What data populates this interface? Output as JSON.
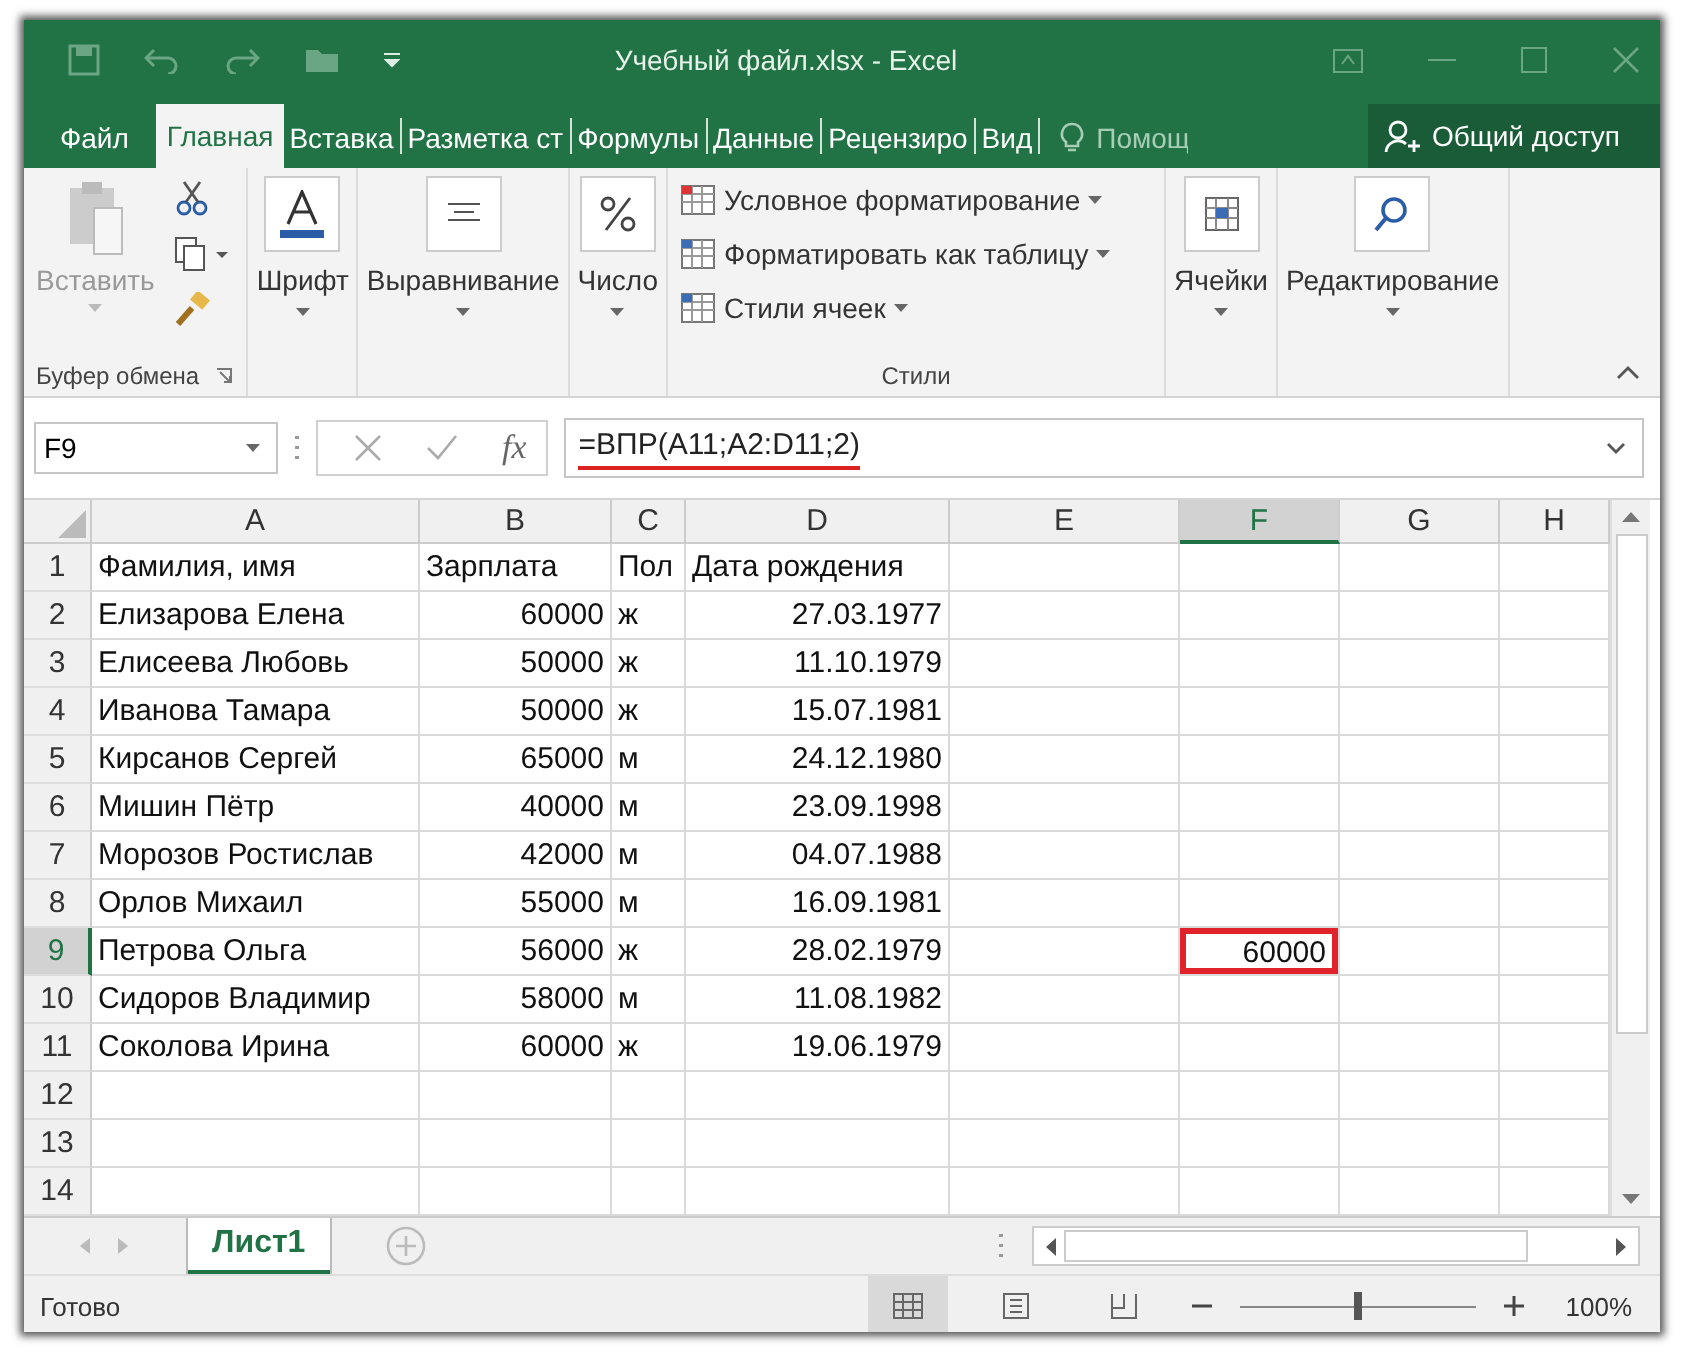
{
  "window": {
    "title": "Учебный файл.xlsx - Excel"
  },
  "ribbon_tabs": [
    {
      "label": "Файл",
      "selected": false
    },
    {
      "label": "Главная",
      "selected": true
    },
    {
      "label": "Вставка",
      "selected": false
    },
    {
      "label": "Разметка ст",
      "selected": false
    },
    {
      "label": "Формулы",
      "selected": false
    },
    {
      "label": "Данные",
      "selected": false
    },
    {
      "label": "Рецензиро",
      "selected": false
    },
    {
      "label": "Вид",
      "selected": false
    }
  ],
  "tell_me": {
    "placeholder": "Помощ"
  },
  "share_button": {
    "label": "Общий доступ"
  },
  "ribbon": {
    "paste": {
      "label": "Вставить",
      "disabled": true
    },
    "clipboard_label": "Буфер обмена",
    "big_buttons": [
      {
        "label": "Шрифт",
        "kind": "font"
      },
      {
        "label": "Выравнивание",
        "kind": "align"
      },
      {
        "label": "Число",
        "kind": "number"
      }
    ],
    "styles": [
      "Условное форматирование",
      "Форматировать как таблицу",
      "Стили ячеек"
    ],
    "styles_label": "Стили",
    "right_buttons": [
      {
        "label": "Ячейки",
        "kind": "cells"
      },
      {
        "label": "Редактирование",
        "kind": "search"
      }
    ]
  },
  "formula_bar": {
    "name_box": "F9",
    "function_button": "fx",
    "formula": "=ВПР(A11;A2:D11;2)",
    "underlined": true
  },
  "columns": [
    "A",
    "B",
    "C",
    "D",
    "E",
    "F",
    "G",
    "H"
  ],
  "rows": [
    {
      "number": "1",
      "cells": [
        "Фамилия, имя",
        "Зарплата",
        "Пол",
        "Дата рождения"
      ]
    },
    {
      "number": "2",
      "cells": [
        "Елизарова Елена",
        "60000",
        "ж",
        "27.03.1977"
      ]
    },
    {
      "number": "3",
      "cells": [
        "Елисеева Любовь",
        "50000",
        "ж",
        "11.10.1979"
      ]
    },
    {
      "number": "4",
      "cells": [
        "Иванова Тамара",
        "50000",
        "ж",
        "15.07.1981"
      ]
    },
    {
      "number": "5",
      "cells": [
        "Кирсанов Сергей",
        "65000",
        "м",
        "24.12.1980"
      ]
    },
    {
      "number": "6",
      "cells": [
        "Мишин Пётр",
        "40000",
        "м",
        "23.09.1998"
      ]
    },
    {
      "number": "7",
      "cells": [
        "Морозов Ростислав",
        "42000",
        "м",
        "04.07.1988"
      ]
    },
    {
      "number": "8",
      "cells": [
        "Орлов Михаил",
        "55000",
        "м",
        "16.09.1981"
      ]
    },
    {
      "number": "9",
      "cells": [
        "Петрова Ольга",
        "56000",
        "ж",
        "28.02.1979"
      ],
      "cell_f": {
        "text": "60000",
        "selected": true,
        "outlined": true
      }
    },
    {
      "number": "10",
      "cells": [
        "Сидоров Владимир",
        "58000",
        "м",
        "11.08.1982"
      ]
    },
    {
      "number": "11",
      "cells": [
        "Соколова Ирина",
        "60000",
        "ж",
        "19.06.1979"
      ]
    },
    {
      "number": "12",
      "cells": []
    },
    {
      "number": "13",
      "cells": []
    },
    {
      "number": "14",
      "cells": []
    }
  ],
  "sheet_tabs": [
    {
      "label": "Лист1",
      "selected": true
    }
  ],
  "status_bar": {
    "status": "Готово",
    "zoom": "100%",
    "zoom_slider": {
      "level": 0.5
    }
  }
}
